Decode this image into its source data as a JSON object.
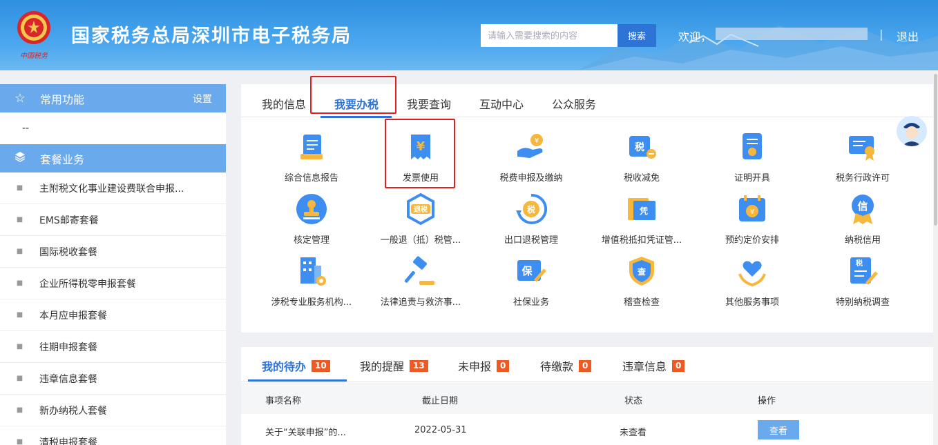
{
  "header": {
    "title": "国家税务总局深圳市电子税务局",
    "search_placeholder": "请输入需要搜索的内容",
    "search_button": "搜索",
    "welcome": "欢迎，",
    "separator": "|",
    "logout": "退出",
    "colors": {
      "header_bg": "#3d9be8",
      "search_btn": "#2d74d6"
    }
  },
  "sidebar": {
    "common": {
      "label": "常用功能",
      "setting": "设置",
      "empty": "--"
    },
    "package": {
      "label": "套餐业务",
      "items": [
        {
          "label": "主附税文化事业建设费联合申报..."
        },
        {
          "label": "EMS邮寄套餐"
        },
        {
          "label": "国际税收套餐"
        },
        {
          "label": "企业所得税零申报套餐"
        },
        {
          "label": "本月应申报套餐"
        },
        {
          "label": "往期申报套餐"
        },
        {
          "label": "违章信息套餐"
        },
        {
          "label": "新办纳税人套餐"
        },
        {
          "label": "清税申报套餐"
        }
      ]
    }
  },
  "main": {
    "tabs": [
      {
        "label": "我的信息"
      },
      {
        "label": "我要办税"
      },
      {
        "label": "我要查询"
      },
      {
        "label": "互动中心"
      },
      {
        "label": "公众服务"
      }
    ],
    "functions": [
      {
        "label": "综合信息报告",
        "icon": "report-icon"
      },
      {
        "label": "发票使用",
        "icon": "invoice-icon"
      },
      {
        "label": "税费申报及缴纳",
        "icon": "tax-payment-icon"
      },
      {
        "label": "税收减免",
        "icon": "tax-reduction-icon"
      },
      {
        "label": "证明开具",
        "icon": "certificate-icon"
      },
      {
        "label": "税务行政许可",
        "icon": "license-icon"
      },
      {
        "label": "核定管理",
        "icon": "stamp-icon"
      },
      {
        "label": "一般退（抵）税管...",
        "icon": "tax-refund-icon"
      },
      {
        "label": "出口退税管理",
        "icon": "export-refund-icon"
      },
      {
        "label": "增值税抵扣凭证管...",
        "icon": "voucher-icon"
      },
      {
        "label": "预约定价安排",
        "icon": "calendar-icon"
      },
      {
        "label": "纳税信用",
        "icon": "credit-icon"
      },
      {
        "label": "涉税专业服务机构...",
        "icon": "building-icon"
      },
      {
        "label": "法律追责与救济事...",
        "icon": "gavel-icon"
      },
      {
        "label": "社保业务",
        "icon": "insurance-icon"
      },
      {
        "label": "稽查检查",
        "icon": "inspection-icon"
      },
      {
        "label": "其他服务事项",
        "icon": "heart-hand-icon"
      },
      {
        "label": "特别纳税调查",
        "icon": "survey-icon"
      }
    ]
  },
  "todo": {
    "tabs": [
      {
        "label": "我的待办",
        "count": "10"
      },
      {
        "label": "我的提醒",
        "count": "13"
      },
      {
        "label": "未申报",
        "count": "0"
      },
      {
        "label": "待缴款",
        "count": "0"
      },
      {
        "label": "违章信息",
        "count": "0"
      }
    ],
    "columns": [
      "事项名称",
      "截止日期",
      "状态",
      "操作"
    ],
    "rows": [
      {
        "name": "关于“关联申报”的...",
        "deadline": "2022-05-31",
        "status": "未查看",
        "action": "查看"
      }
    ]
  }
}
